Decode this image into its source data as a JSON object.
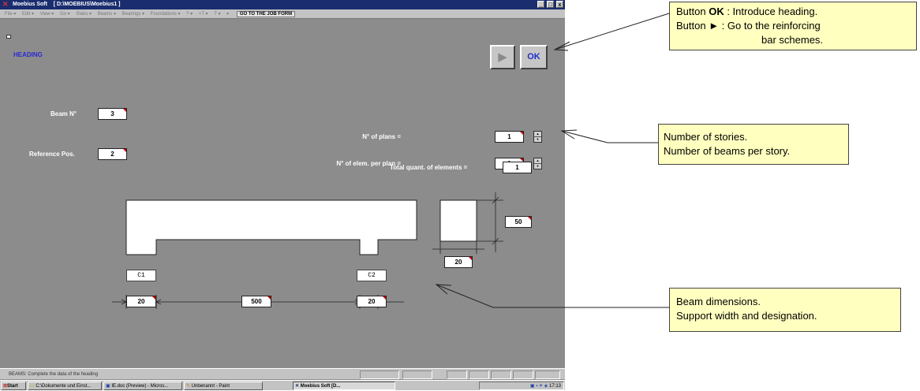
{
  "window": {
    "title": "Moebius Soft    [ D:\\MOEBIUS\\Moebius1 ]",
    "min": "_",
    "max": "□",
    "close": "x"
  },
  "menubar": {
    "items": [
      "File ▾",
      "Edit ▾",
      "View ▾",
      "Go ▾",
      "Slabs ▾",
      "Beams ▾",
      "Bearings ▾",
      "Foundations ▾",
      "? ▾",
      "+T ▾",
      "T ▾",
      "▾"
    ],
    "job_form": "GO TO THE JOB FORM"
  },
  "form": {
    "title": "HEADING",
    "next_label": "▶",
    "ok_label": "OK",
    "beam_label": "Beam N°",
    "beam_value": "3",
    "ref_label": "Reference Pos.",
    "ref_value": "2",
    "plans_label": "N° of plans =",
    "plans_value": "1",
    "elem_label": "N° of elem. per plan =",
    "elem_value": "1",
    "total_label": "Total quant. of elements =",
    "total_value": "1",
    "section_height": "50",
    "section_width": "20",
    "support_left_name": "C1",
    "support_right_name": "C2",
    "support_left_width": "20",
    "span_length": "500",
    "support_right_width": "20"
  },
  "statusbar": {
    "text": "BEAMS: Complete the data of the heading"
  },
  "taskbar": {
    "start": "Start",
    "tasks": [
      "C:\\Dokumente und Einst...",
      "IE.doc (Preview) - Micros...",
      "Unbenannt - Paint",
      "Moebius Soft    [D..."
    ],
    "clock": "17:13"
  },
  "notes": {
    "ok_line1_prefix": "Button ",
    "ok_line1_bold": "OK",
    "ok_line1_suffix": " : Introduce heading.",
    "ok_line2": "Button     ► : Go to the reinforcing",
    "ok_line3": "bar schemes.",
    "stories_line1": "Number of stories.",
    "stories_line2": "Number of beams per story.",
    "beam_line1": "Beam dimensions.",
    "beam_line2": "Support width and designation."
  },
  "colors": {
    "window_bg": "#8c8c8c",
    "title_bar": "#1a2d6e",
    "heading_text": "#2a2ad4",
    "note_bg": "#ffffc0"
  }
}
